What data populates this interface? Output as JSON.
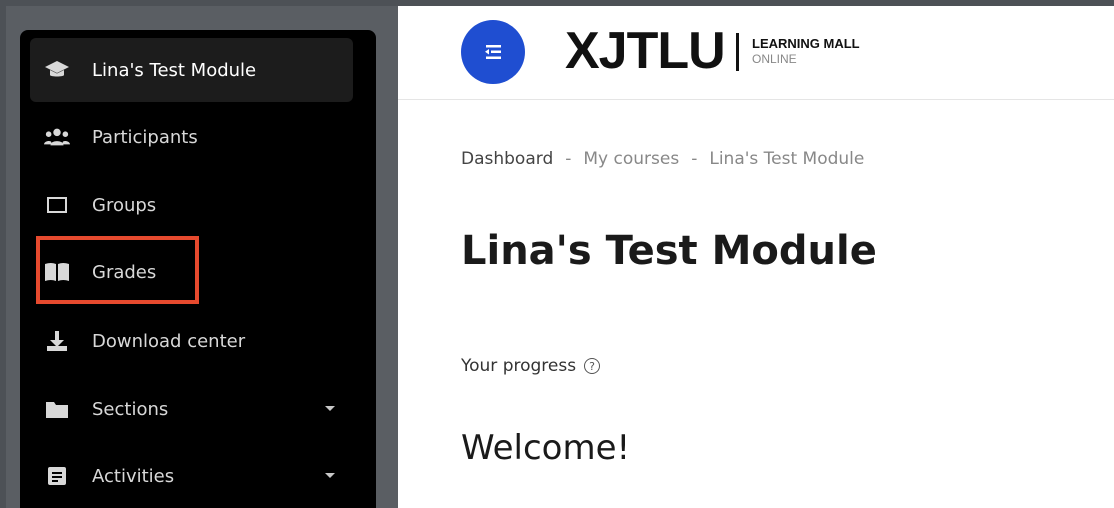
{
  "sidebar": {
    "items": [
      {
        "label": "Lina's Test Module",
        "icon": "graduation-cap-icon",
        "active": true
      },
      {
        "label": "Participants",
        "icon": "users-icon"
      },
      {
        "label": "Groups",
        "icon": "square-icon"
      },
      {
        "label": "Grades",
        "icon": "book-icon",
        "highlighted": true
      },
      {
        "label": "Download center",
        "icon": "download-icon"
      },
      {
        "label": "Sections",
        "icon": "folder-icon",
        "expandable": true
      },
      {
        "label": "Activities",
        "icon": "document-icon",
        "expandable": true
      }
    ]
  },
  "header": {
    "logo_main": "XJTLU",
    "logo_sub1": "LEARNING MALL",
    "logo_sub2": "ONLINE",
    "drawer_icon": "menu-collapse-icon"
  },
  "breadcrumb": {
    "items": [
      "Dashboard",
      "My courses",
      "Lina's Test Module"
    ],
    "separator": "-"
  },
  "page": {
    "title": "Lina's Test Module",
    "progress_label": "Your progress",
    "help_glyph": "?",
    "welcome": "Welcome!"
  },
  "colors": {
    "sidebar_bg": "#000000",
    "accent": "#1f4ed1",
    "highlight": "#e64a2e"
  }
}
